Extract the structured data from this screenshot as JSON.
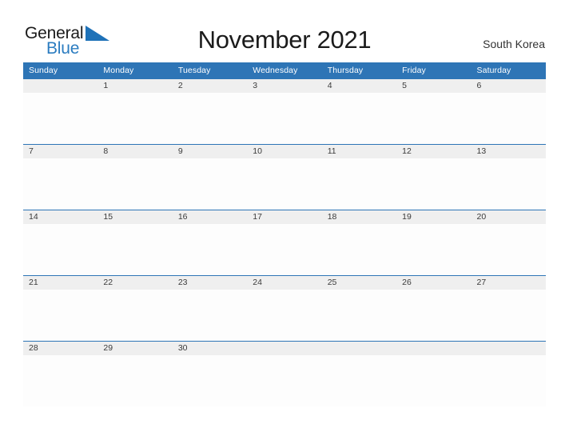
{
  "brand": {
    "name_top": "General",
    "name_bottom": "Blue",
    "flag_icon": "blue-flag-triangle-icon",
    "color_primary": "#2b7cc0",
    "color_text": "#1a1a1a"
  },
  "header": {
    "title": "November 2021",
    "region": "South Korea"
  },
  "calendar": {
    "colors": {
      "header_bg": "#2e75b6",
      "header_text": "#ffffff",
      "row_rule": "#2e75b6",
      "date_band_bg": "#efefef",
      "date_text": "#3a3a3a",
      "cell_bg": "#fdfdfd"
    },
    "weekday_headers": [
      "Sunday",
      "Monday",
      "Tuesday",
      "Wednesday",
      "Thursday",
      "Friday",
      "Saturday"
    ],
    "weeks": [
      [
        "",
        "1",
        "2",
        "3",
        "4",
        "5",
        "6"
      ],
      [
        "7",
        "8",
        "9",
        "10",
        "11",
        "12",
        "13"
      ],
      [
        "14",
        "15",
        "16",
        "17",
        "18",
        "19",
        "20"
      ],
      [
        "21",
        "22",
        "23",
        "24",
        "25",
        "26",
        "27"
      ],
      [
        "28",
        "29",
        "30",
        "",
        "",
        "",
        ""
      ]
    ]
  }
}
